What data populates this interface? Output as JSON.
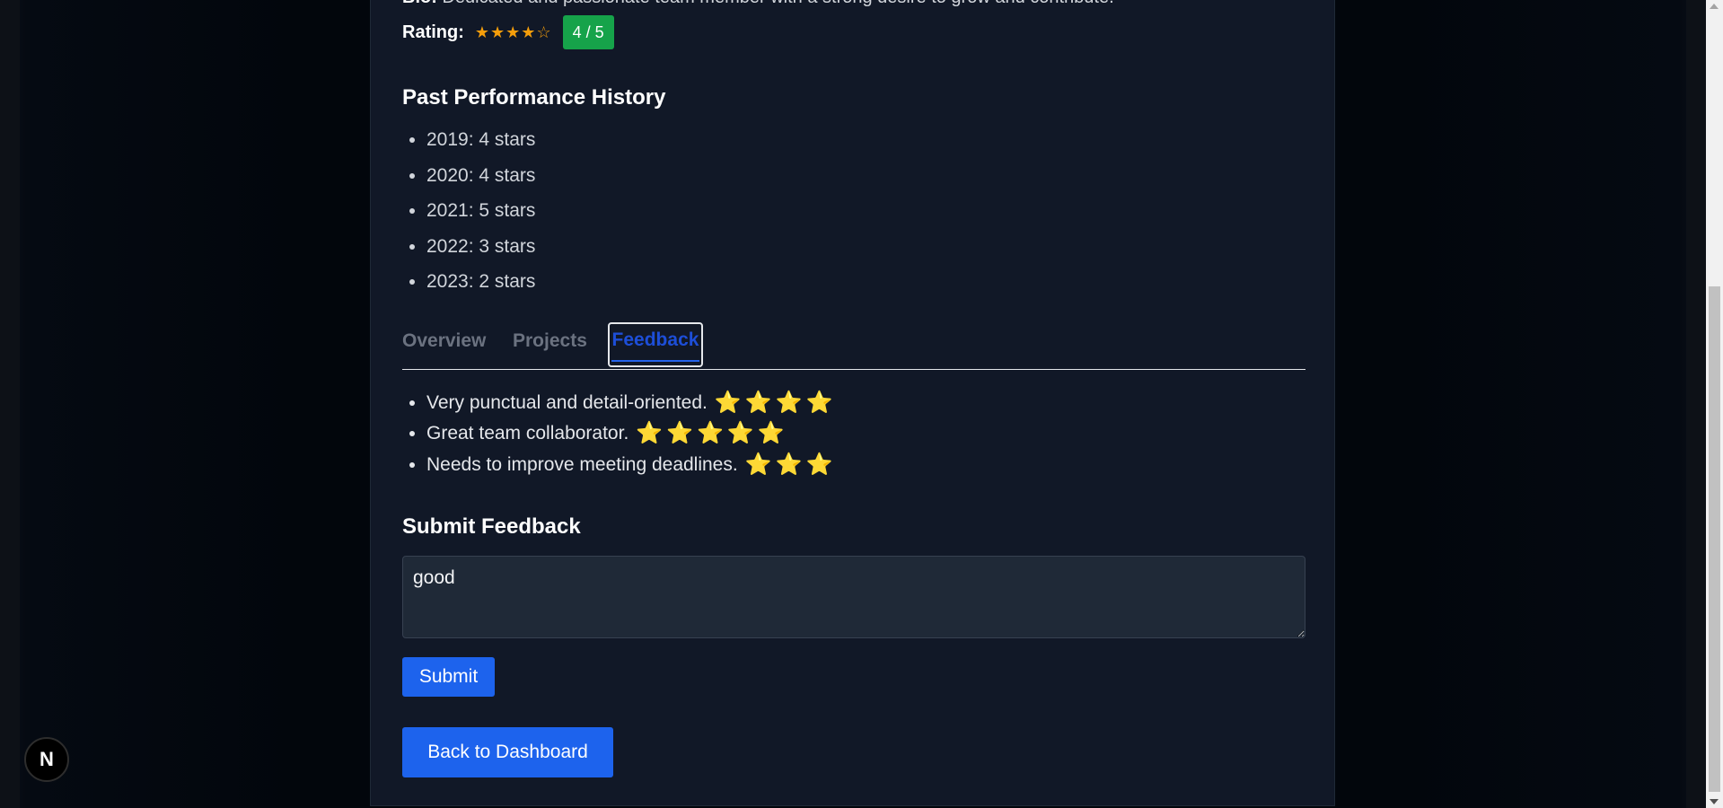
{
  "profile": {
    "bio_label": "Bio:",
    "bio_text": "Dedicated and passionate team member with a strong desire to grow and contribute.",
    "rating_label": "Rating:",
    "rating_stars": "★★★★☆",
    "rating_value": 4,
    "rating_badge": "4 / 5"
  },
  "history": {
    "title": "Past Performance History",
    "items": [
      "2019: 4 stars",
      "2020: 4 stars",
      "2021: 5 stars",
      "2022: 3 stars",
      "2023: 2 stars"
    ]
  },
  "tabs": {
    "items": [
      {
        "label": "Overview"
      },
      {
        "label": "Projects"
      },
      {
        "label": "Feedback"
      }
    ],
    "active": "Feedback"
  },
  "feedback": {
    "items": [
      {
        "text": "Very punctual and detail-oriented.",
        "stars": "⭐⭐⭐⭐",
        "star_count": 4
      },
      {
        "text": "Great team collaborator.",
        "stars": "⭐⭐⭐⭐⭐",
        "star_count": 5
      },
      {
        "text": "Needs to improve meeting deadlines.",
        "stars": "⭐⭐⭐",
        "star_count": 3
      }
    ]
  },
  "submit_form": {
    "title": "Submit Feedback",
    "textarea_value": "good",
    "submit_label": "Submit"
  },
  "navigation": {
    "back_label": "Back to Dashboard"
  },
  "dev_badge": {
    "letter": "N",
    "icon": "nextjs-icon"
  },
  "colors": {
    "page_bg": "#02060c",
    "card_bg": "#111827",
    "accent_blue": "#1d63ed",
    "badge_green": "#16a34a",
    "star_gold": "#f59e0b",
    "active_tab": "#1d4ed8",
    "inactive_tab": "#6b7280"
  }
}
